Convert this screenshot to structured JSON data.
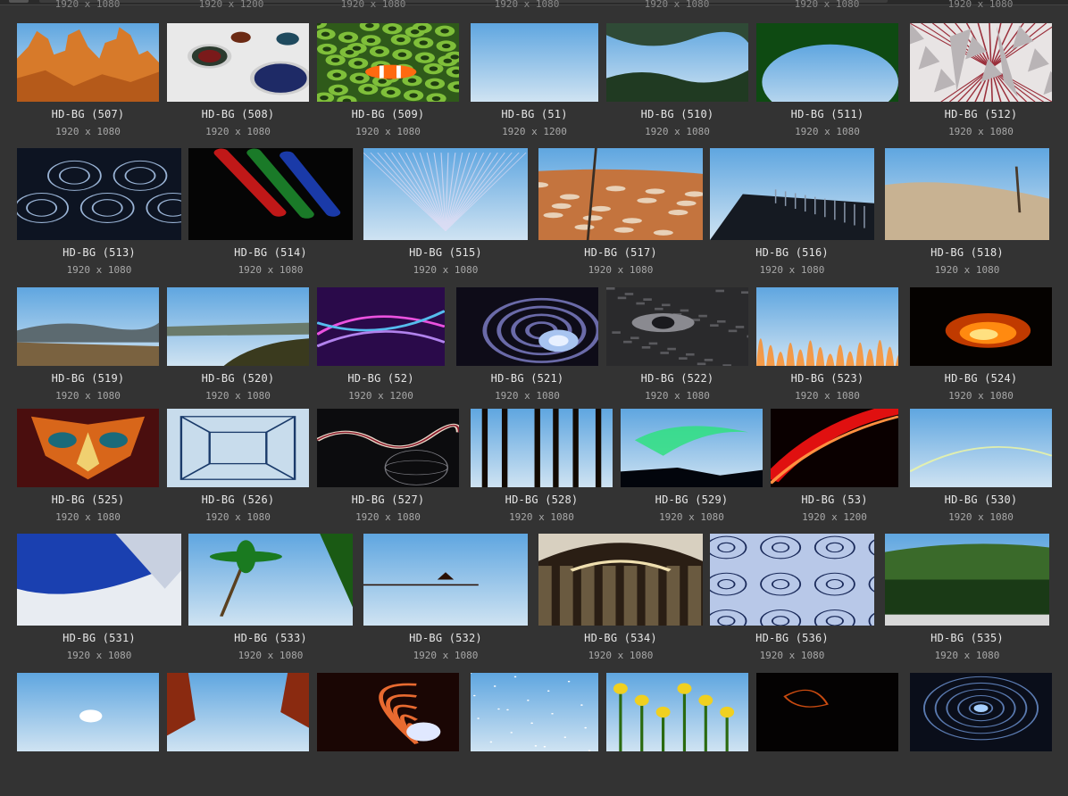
{
  "top_row_dims": [
    "1920 x 1080",
    "1920 x 1200",
    "1920 x 1080",
    "1920 x 1080",
    "1920 x 1080",
    "1920 x 1080",
    "1920 x 1080"
  ],
  "rows": [
    {
      "items": [
        {
          "name": "HD-BG (507)",
          "dims": "1920 x 1080",
          "art": "canyon"
        },
        {
          "name": "HD-BG (508)",
          "dims": "1920 x 1080",
          "art": "spheres"
        },
        {
          "name": "HD-BG (509)",
          "dims": "1920 x 1080",
          "art": "clownfish"
        },
        {
          "name": "HD-BG (51)",
          "dims": "1920 x 1200",
          "art": "greengrad"
        },
        {
          "name": "HD-BG (510)",
          "dims": "1920 x 1080",
          "art": "greenvalley"
        },
        {
          "name": "HD-BG (511)",
          "dims": "1920 x 1080",
          "art": "dandelion"
        },
        {
          "name": "HD-BG (512)",
          "dims": "1920 x 1080",
          "art": "abstractwhite"
        }
      ]
    },
    {
      "items": [
        {
          "name": "HD-BG (513)",
          "dims": "1920 x 1080",
          "art": "fractalblue"
        },
        {
          "name": "HD-BG (514)",
          "dims": "1920 x 1080",
          "art": "pencils"
        },
        {
          "name": "HD-BG (515)",
          "dims": "1920 x 1080",
          "art": "purplefluff"
        },
        {
          "name": "HD-BG (517)",
          "dims": "1920 x 1080",
          "art": "desertcanyon"
        },
        {
          "name": "HD-BG (516)",
          "dims": "1920 x 1080",
          "art": "pier"
        },
        {
          "name": "HD-BG (518)",
          "dims": "1920 x 1080",
          "art": "hillside"
        }
      ]
    },
    {
      "items": [
        {
          "name": "HD-BG (519)",
          "dims": "1920 x 1080",
          "art": "misthills"
        },
        {
          "name": "HD-BG (520)",
          "dims": "1920 x 1080",
          "art": "lakeshore"
        },
        {
          "name": "HD-BG (52)",
          "dims": "1920 x 1200",
          "art": "purplelight"
        },
        {
          "name": "HD-BG (521)",
          "dims": "1920 x 1080",
          "art": "fractalorb"
        },
        {
          "name": "HD-BG (522)",
          "dims": "1920 x 1080",
          "art": "eye"
        },
        {
          "name": "HD-BG (523)",
          "dims": "1920 x 1080",
          "art": "fire"
        },
        {
          "name": "HD-BG (524)",
          "dims": "1920 x 1080",
          "art": "fireball"
        }
      ]
    },
    {
      "items": [
        {
          "name": "HD-BG (525)",
          "dims": "1920 x 1080",
          "art": "mask"
        },
        {
          "name": "HD-BG (526)",
          "dims": "1920 x 1080",
          "art": "bluerooms"
        },
        {
          "name": "HD-BG (527)",
          "dims": "1920 x 1080",
          "art": "fractalsphere"
        },
        {
          "name": "HD-BG (528)",
          "dims": "1920 x 1080",
          "art": "forest"
        },
        {
          "name": "HD-BG (529)",
          "dims": "1920 x 1080",
          "art": "aurora"
        },
        {
          "name": "HD-BG (53)",
          "dims": "1920 x 1200",
          "art": "redstreak"
        },
        {
          "name": "HD-BG (530)",
          "dims": "1920 x 1080",
          "art": "vista"
        }
      ]
    },
    {
      "items": [
        {
          "name": "HD-BG (531)",
          "dims": "1920 x 1080",
          "art": "bluewhite"
        },
        {
          "name": "HD-BG (533)",
          "dims": "1920 x 1080",
          "art": "beach"
        },
        {
          "name": "HD-BG (532)",
          "dims": "1920 x 1080",
          "art": "sunset"
        },
        {
          "name": "HD-BG (534)",
          "dims": "1920 x 1080",
          "art": "dome"
        },
        {
          "name": "HD-BG (536)",
          "dims": "1920 x 1080",
          "art": "fractalpattern"
        },
        {
          "name": "HD-BG (535)",
          "dims": "1920 x 1080",
          "art": "river"
        }
      ]
    },
    {
      "items": [
        {
          "art": "lamp"
        },
        {
          "art": "redsunset"
        },
        {
          "art": "swirl"
        },
        {
          "art": "pinkstars"
        },
        {
          "art": "tulips"
        },
        {
          "art": "darkember"
        },
        {
          "art": "fractaltemple"
        }
      ]
    }
  ]
}
